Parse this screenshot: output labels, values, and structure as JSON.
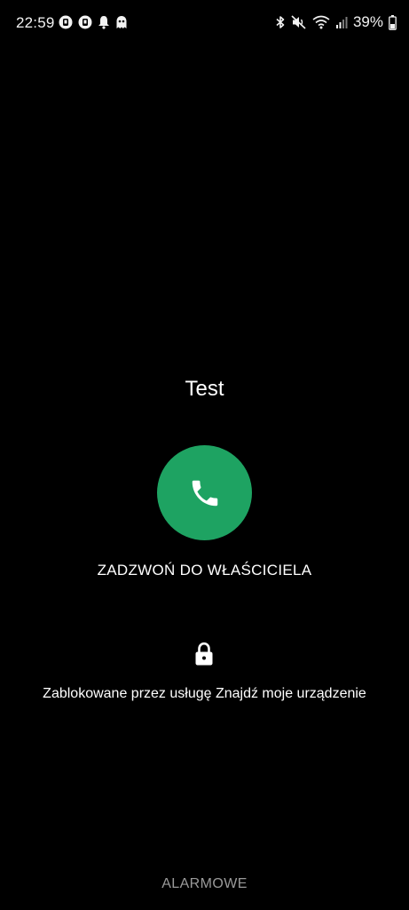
{
  "status_bar": {
    "time": "22:59",
    "battery_percent": "39%",
    "left_icons": [
      "notification-app-icon",
      "notification-app-icon",
      "notification-bell-icon",
      "ghost-icon"
    ],
    "right_icons": [
      "bluetooth-icon",
      "mute-icon",
      "wifi-icon",
      "signal-icon",
      "battery-icon"
    ]
  },
  "lock_screen": {
    "owner_name": "Test",
    "call_button_label": "ZADZWOŃ DO WŁAŚCICIELA",
    "locked_message": "Zablokowane przez usługę Znajdź moje urządzenie",
    "emergency_label": "ALARMOWE"
  },
  "colors": {
    "background": "#000000",
    "call_button": "#1ea362",
    "emergency_text": "#9a9a9a"
  }
}
